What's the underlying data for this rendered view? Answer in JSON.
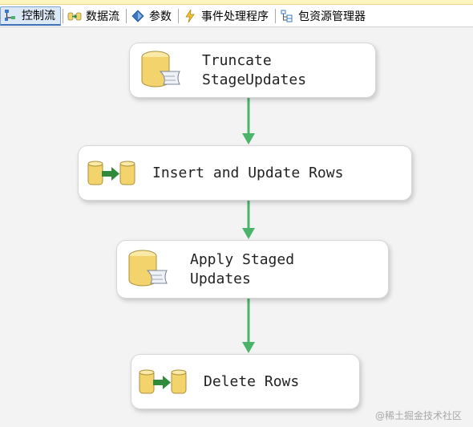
{
  "tabs": [
    {
      "label": "控制流",
      "icon": "control-flow-icon",
      "active": true
    },
    {
      "label": "数据流",
      "icon": "data-flow-icon",
      "active": false
    },
    {
      "label": "参数",
      "icon": "parameters-icon",
      "active": false
    },
    {
      "label": "事件处理程序",
      "icon": "event-handlers-icon",
      "active": false
    },
    {
      "label": "包资源管理器",
      "icon": "package-explorer-icon",
      "active": false
    }
  ],
  "tasks": [
    {
      "label": "Truncate\nStageUpdates",
      "icon": "sql-task-icon"
    },
    {
      "label": "Insert and Update Rows",
      "icon": "data-flow-task-icon"
    },
    {
      "label": "Apply Staged\nUpdates",
      "icon": "sql-task-icon"
    },
    {
      "label": "Delete Rows",
      "icon": "data-flow-task-icon"
    }
  ],
  "watermark": "@稀土掘金技术社区",
  "colors": {
    "connector": "#4cb36a",
    "active_tab": "#dce8f6",
    "cylinder": "#f3d36b"
  }
}
